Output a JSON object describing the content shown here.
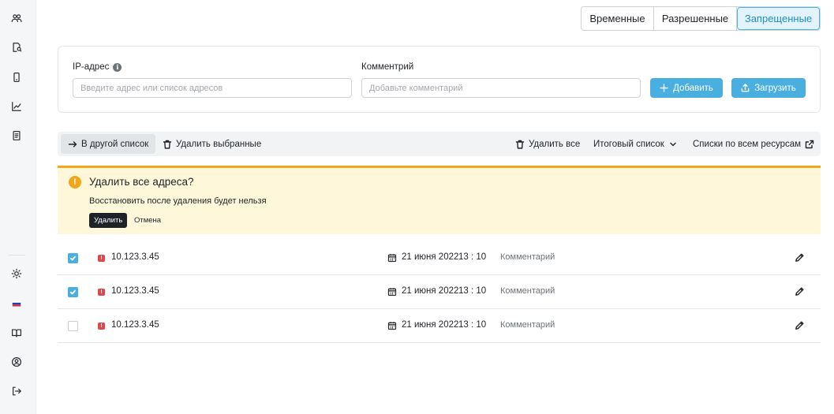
{
  "sidebar": {
    "icons": [
      "users-icon",
      "search-document-icon",
      "mobile-icon",
      "chart-icon",
      "document-icon",
      "sun-icon",
      "language-flag-icon",
      "book-icon",
      "profile-icon",
      "logout-icon"
    ]
  },
  "tabs": [
    "Временные",
    "Разрешенные",
    "Запрещенные"
  ],
  "form": {
    "ip_label": "IP-адрес",
    "ip_placeholder": "Введите адрес или список адресов",
    "comment_label": "Комментрий",
    "comment_placeholder": "Добавьте комментарий",
    "add_label": "Добавить",
    "upload_label": "Загрузить"
  },
  "toolbar": {
    "move_label": "В другой список",
    "delete_selected_label": "Удалить выбранные",
    "delete_all_label": "Удалить все",
    "final_list_label": "Итоговый список",
    "all_resources_label": "Списки по всем ресурсам"
  },
  "warning": {
    "title": "Удалить все адреса?",
    "text": "Восстановить после удаления будет нельзя",
    "delete_label": "Удалить",
    "cancel_label": "Отмена"
  },
  "rows": [
    {
      "checked": true,
      "ip": "10.123.3.45",
      "date": "21 июня 2022",
      "time": "13 : 10",
      "comment": "Комментарий"
    },
    {
      "checked": true,
      "ip": "10.123.3.45",
      "date": "21 июня 2022",
      "time": "13 : 10",
      "comment": "Комментарий"
    },
    {
      "checked": false,
      "ip": "10.123.3.45",
      "date": "21 июня 2022",
      "time": "13 : 10",
      "comment": "Комментарий"
    }
  ],
  "colors": {
    "accent": "#49aee0",
    "warning": "#f2a71b",
    "danger": "#e0474b"
  }
}
